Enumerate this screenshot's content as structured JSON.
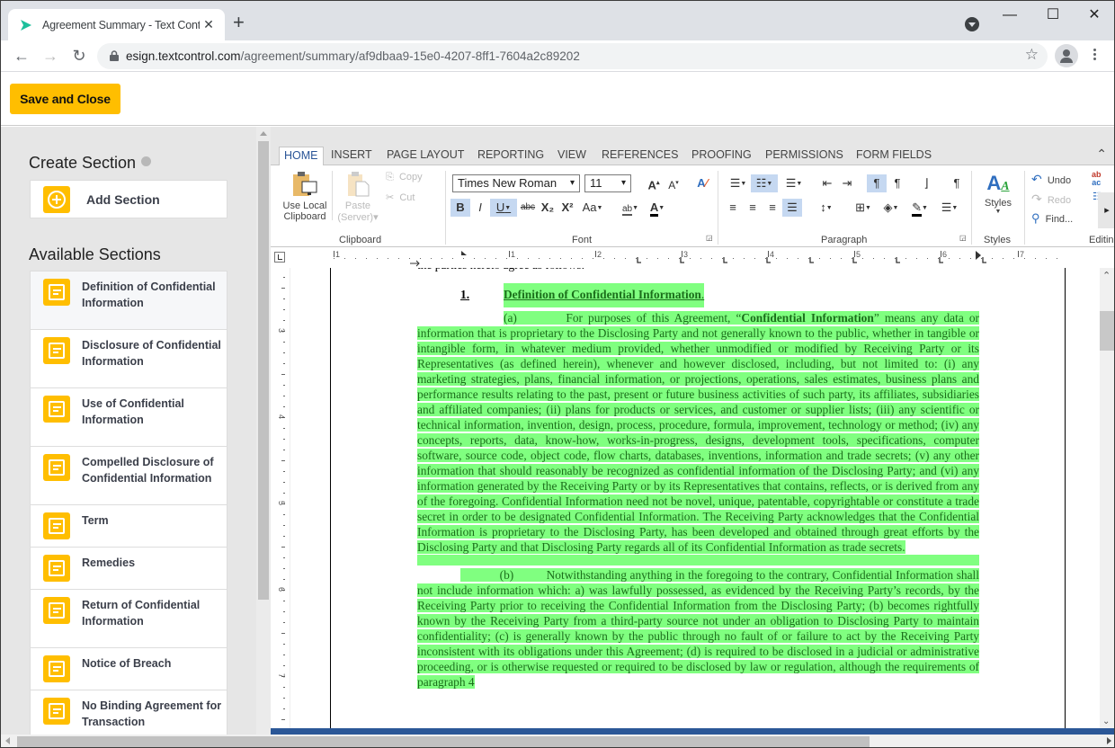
{
  "browser": {
    "tab_title": "Agreement Summary - Text Control",
    "tab_close": "✕",
    "new_tab": "+",
    "url_host": "esign.textcontrol.com",
    "url_path": "/agreement/summary/af9dbaa9-15e0-4207-8ff1-7604a2c89202",
    "window_controls": {
      "minimize": "—",
      "maximize": "☐",
      "close": "✕"
    },
    "nav": {
      "back": "←",
      "forward": "→",
      "reload": "↻",
      "bookmark": "☆"
    }
  },
  "app": {
    "save_close_label": "Save and Close",
    "accent_color": "#ffbe00"
  },
  "sidebar": {
    "create_title": "Create Section",
    "add_section_label": "Add Section",
    "available_title": "Available Sections",
    "sections": [
      {
        "label": "Definition of Confidential Information"
      },
      {
        "label": "Disclosure of Confidential Information"
      },
      {
        "label": "Use of Confidential Information"
      },
      {
        "label": "Compelled Disclosure of Confidential Information"
      },
      {
        "label": "Term"
      },
      {
        "label": "Remedies"
      },
      {
        "label": "Return of Confidential Information"
      },
      {
        "label": "Notice of Breach"
      },
      {
        "label": "No Binding Agreement for Transaction"
      }
    ]
  },
  "ribbon": {
    "tabs": [
      "HOME",
      "INSERT",
      "PAGE LAYOUT",
      "REPORTING",
      "VIEW",
      "REFERENCES",
      "PROOFING",
      "PERMISSIONS",
      "FORM FIELDS"
    ],
    "active_tab": "HOME",
    "clipboard": {
      "use_local_1": "Use Local",
      "use_local_2": "Clipboard",
      "paste_1": "Paste",
      "paste_2": "(Server)▾",
      "copy": "Copy",
      "cut": "Cut",
      "group": "Clipboard"
    },
    "font": {
      "family": "Times New Roman",
      "size": "11",
      "bold": "B",
      "italic": "I",
      "underline": "U",
      "strike": "abc",
      "subscript": "X₂",
      "superscript": "X²",
      "change_case": "Aa",
      "grow": "A",
      "shrink": "A",
      "group": "Font"
    },
    "paragraph": {
      "group": "Paragraph"
    },
    "styles": {
      "label": "Styles",
      "group": "Styles"
    },
    "editing": {
      "undo": "Undo",
      "redo": "Redo",
      "find": "Find...",
      "group": "Editing"
    }
  },
  "ruler": {
    "h_numbers": [
      "1",
      "1",
      "2",
      "3",
      "4",
      "5",
      "6",
      "7"
    ],
    "v_numbers": [
      "3",
      "4",
      "5",
      "6",
      "7"
    ]
  },
  "document": {
    "pre_text": "the parties hereto agree as follows:",
    "section_number": "1.",
    "section_heading": "Definition of Confidential Information",
    "para_a_label": "(a)",
    "para_a_intro": "For purposes of this Agreement, “",
    "para_a_term": "Confidential Information",
    "para_a_body": "” means any data or information that is proprietary to the Disclosing Party and not generally known to the public, whether in tangible or intangible form, in whatever medium provided, whether unmodified or modified by Receiving Party or its Representatives (as defined herein), whenever and however disclosed, including, but not limited to: (i) any marketing strategies, plans, financial information, or projections, operations, sales estimates, business plans and performance results relating to the past, present or future business activities of such party, its affiliates, subsidiaries and affiliated companies; (ii) plans for products or services, and customer or supplier lists; (iii) any scientific or technical information, invention, design, process, procedure, formula, improvement, technology or method; (iv) any concepts, reports, data, know-how, works-in-progress, designs, development tools, specifications, computer software, source code, object code, flow charts, databases, inventions, information and trade secrets; (v) any other information that should reasonably be recognized as confidential information of the Disclosing Party; and (vi) any information generated by the Receiving Party or by its Representatives that contains, reflects, or is derived from any of the foregoing.  Confidential Information need not be novel, unique, patentable, copyrightable or constitute a trade secret in order to be designated Confidential Information.  The Receiving Party acknowledges that the Confidential Information is proprietary to the Disclosing Party, has been developed and obtained through great efforts by the Disclosing Party and that Disclosing Party regards all of its Confidential Information as trade secrets.",
    "para_b_label": "(b)",
    "para_b_body": "Notwithstanding anything in the foregoing to the contrary, Confidential Information shall not include information which: a) was lawfully possessed, as evidenced by the Receiving Party’s records, by the Receiving Party prior to receiving the Confidential Information from the Disclosing Party; (b) becomes rightfully known by the Receiving Party from a third-party source not under an obligation to Disclosing Party to maintain confidentiality; (c) is generally known by the public through no fault of or failure to act by the Receiving Party inconsistent with its obligations under this Agreement; (d) is required to be disclosed in a judicial or administrative proceeding, or is otherwise requested or required to be disclosed by law or regulation, although the requirements of paragraph 4",
    "highlight_color": "#80ff80"
  }
}
